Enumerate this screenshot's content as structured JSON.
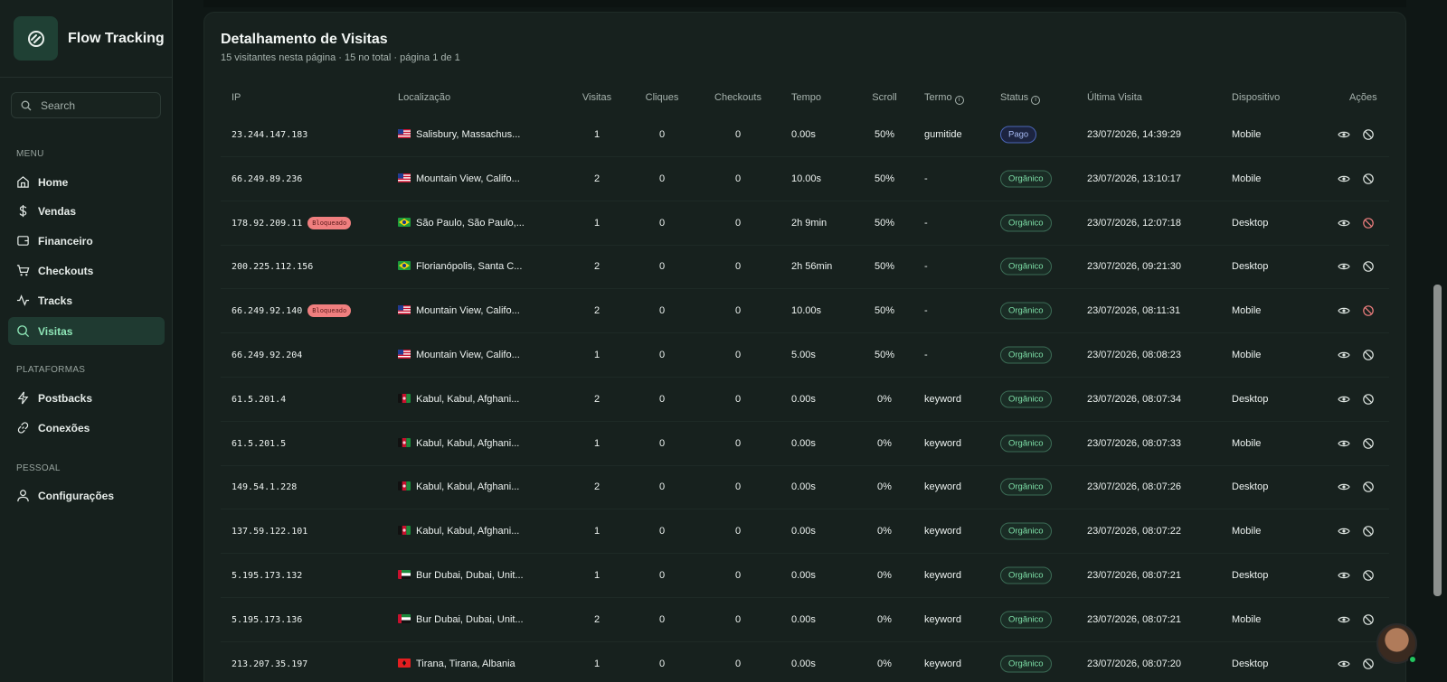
{
  "app": {
    "name": "Flow Tracking"
  },
  "sidebar": {
    "search_placeholder": "Search",
    "sections": {
      "menu": "MENU",
      "platforms": "PLATAFORMAS",
      "personal": "PESSOAL"
    },
    "items": [
      {
        "label": "Home",
        "icon": "home-icon"
      },
      {
        "label": "Vendas",
        "icon": "dollar-icon"
      },
      {
        "label": "Financeiro",
        "icon": "wallet-icon"
      },
      {
        "label": "Checkouts",
        "icon": "cart-icon"
      },
      {
        "label": "Tracks",
        "icon": "activity-icon"
      },
      {
        "label": "Visitas",
        "icon": "search-icon",
        "active": true
      },
      {
        "label": "Postbacks",
        "icon": "zap-icon"
      },
      {
        "label": "Conexões",
        "icon": "link-icon"
      },
      {
        "label": "Configurações",
        "icon": "user-icon"
      }
    ]
  },
  "panel": {
    "title": "Detalhamento de Visitas",
    "subtitle": "15 visitantes nesta página · 15 no total · página 1 de 1"
  },
  "table": {
    "headers": {
      "ip": "IP",
      "location": "Localização",
      "visits": "Visitas",
      "clicks": "Cliques",
      "checkouts": "Checkouts",
      "time": "Tempo",
      "scroll": "Scroll",
      "term": "Termo",
      "status": "Status",
      "last_visit": "Última Visita",
      "device": "Dispositivo",
      "actions": "Ações"
    },
    "blocked_label": "Bloqueado",
    "rows": [
      {
        "ip": "23.244.147.183",
        "blocked": false,
        "flag": "us",
        "location": "Salisbury, Massachus...",
        "visits": "1",
        "clicks": "0",
        "checkouts": "0",
        "time": "0.00s",
        "scroll": "50%",
        "term": "gumitide",
        "status": "Pago",
        "last_visit": "23/07/2026, 14:39:29",
        "device": "Mobile"
      },
      {
        "ip": "66.249.89.236",
        "blocked": false,
        "flag": "us",
        "location": "Mountain View, Califo...",
        "visits": "2",
        "clicks": "0",
        "checkouts": "0",
        "time": "10.00s",
        "scroll": "50%",
        "term": "-",
        "status": "Orgânico",
        "last_visit": "23/07/2026, 13:10:17",
        "device": "Mobile"
      },
      {
        "ip": "178.92.209.11",
        "blocked": true,
        "flag": "br",
        "location": "São Paulo, São Paulo,...",
        "visits": "1",
        "clicks": "0",
        "checkouts": "0",
        "time": "2h 9min",
        "scroll": "50%",
        "term": "-",
        "status": "Orgânico",
        "last_visit": "23/07/2026, 12:07:18",
        "device": "Desktop"
      },
      {
        "ip": "200.225.112.156",
        "blocked": false,
        "flag": "br",
        "location": "Florianópolis, Santa C...",
        "visits": "2",
        "clicks": "0",
        "checkouts": "0",
        "time": "2h 56min",
        "scroll": "50%",
        "term": "-",
        "status": "Orgânico",
        "last_visit": "23/07/2026, 09:21:30",
        "device": "Desktop"
      },
      {
        "ip": "66.249.92.140",
        "blocked": true,
        "flag": "us",
        "location": "Mountain View, Califo...",
        "visits": "2",
        "clicks": "0",
        "checkouts": "0",
        "time": "10.00s",
        "scroll": "50%",
        "term": "-",
        "status": "Orgânico",
        "last_visit": "23/07/2026, 08:11:31",
        "device": "Mobile"
      },
      {
        "ip": "66.249.92.204",
        "blocked": false,
        "flag": "us",
        "location": "Mountain View, Califo...",
        "visits": "1",
        "clicks": "0",
        "checkouts": "0",
        "time": "5.00s",
        "scroll": "50%",
        "term": "-",
        "status": "Orgânico",
        "last_visit": "23/07/2026, 08:08:23",
        "device": "Mobile"
      },
      {
        "ip": "61.5.201.4",
        "blocked": false,
        "flag": "af",
        "location": "Kabul, Kabul, Afghani...",
        "visits": "2",
        "clicks": "0",
        "checkouts": "0",
        "time": "0.00s",
        "scroll": "0%",
        "term": "keyword",
        "status": "Orgânico",
        "last_visit": "23/07/2026, 08:07:34",
        "device": "Desktop"
      },
      {
        "ip": "61.5.201.5",
        "blocked": false,
        "flag": "af",
        "location": "Kabul, Kabul, Afghani...",
        "visits": "1",
        "clicks": "0",
        "checkouts": "0",
        "time": "0.00s",
        "scroll": "0%",
        "term": "keyword",
        "status": "Orgânico",
        "last_visit": "23/07/2026, 08:07:33",
        "device": "Mobile"
      },
      {
        "ip": "149.54.1.228",
        "blocked": false,
        "flag": "af",
        "location": "Kabul, Kabul, Afghani...",
        "visits": "2",
        "clicks": "0",
        "checkouts": "0",
        "time": "0.00s",
        "scroll": "0%",
        "term": "keyword",
        "status": "Orgânico",
        "last_visit": "23/07/2026, 08:07:26",
        "device": "Desktop"
      },
      {
        "ip": "137.59.122.101",
        "blocked": false,
        "flag": "af",
        "location": "Kabul, Kabul, Afghani...",
        "visits": "1",
        "clicks": "0",
        "checkouts": "0",
        "time": "0.00s",
        "scroll": "0%",
        "term": "keyword",
        "status": "Orgânico",
        "last_visit": "23/07/2026, 08:07:22",
        "device": "Mobile"
      },
      {
        "ip": "5.195.173.132",
        "blocked": false,
        "flag": "ae",
        "location": "Bur Dubai, Dubai, Unit...",
        "visits": "1",
        "clicks": "0",
        "checkouts": "0",
        "time": "0.00s",
        "scroll": "0%",
        "term": "keyword",
        "status": "Orgânico",
        "last_visit": "23/07/2026, 08:07:21",
        "device": "Desktop"
      },
      {
        "ip": "5.195.173.136",
        "blocked": false,
        "flag": "ae",
        "location": "Bur Dubai, Dubai, Unit...",
        "visits": "2",
        "clicks": "0",
        "checkouts": "0",
        "time": "0.00s",
        "scroll": "0%",
        "term": "keyword",
        "status": "Orgânico",
        "last_visit": "23/07/2026, 08:07:21",
        "device": "Mobile"
      },
      {
        "ip": "213.207.35.197",
        "blocked": false,
        "flag": "al",
        "location": "Tirana, Tirana, Albania",
        "visits": "1",
        "clicks": "0",
        "checkouts": "0",
        "time": "0.00s",
        "scroll": "0%",
        "term": "keyword",
        "status": "Orgânico",
        "last_visit": "23/07/2026, 08:07:20",
        "device": "Desktop"
      }
    ]
  },
  "colors": {
    "accent": "#8ee6b7",
    "blocked": "#f07f7f",
    "pago": "#a8bcf5",
    "organic": "#7ee0a8",
    "online": "#22c55e"
  }
}
